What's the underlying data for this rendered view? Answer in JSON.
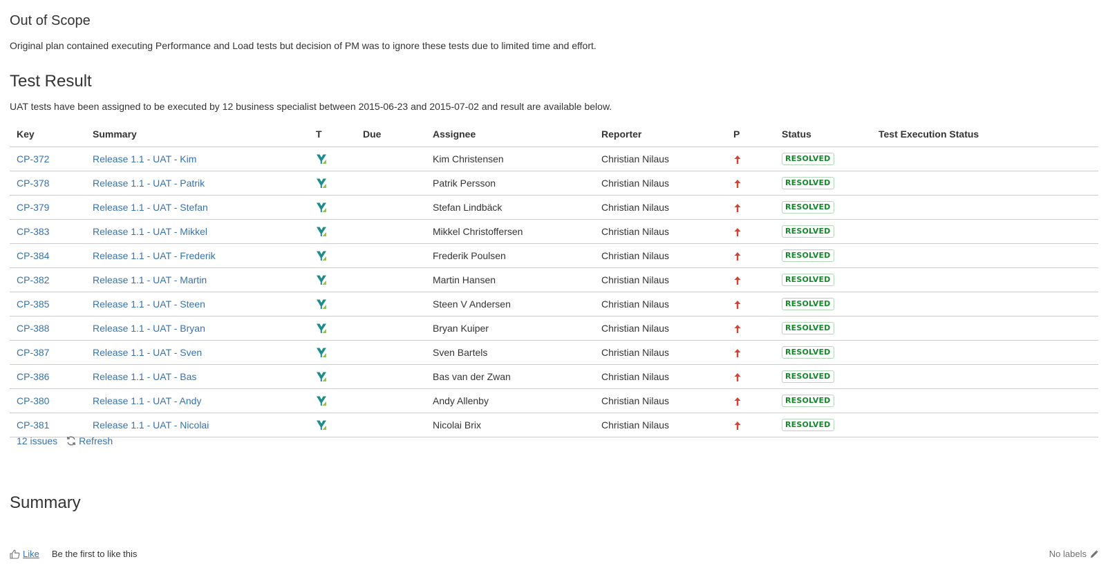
{
  "out_of_scope": {
    "title": "Out of Scope",
    "description": "Original plan contained executing Performance and Load tests but decision of PM was to ignore these tests due to limited time and effort."
  },
  "test_result": {
    "title": "Test Result",
    "description": "UAT tests have been assigned to be executed by 12 business specialist between 2015-06-23 and 2015-07-02 and result are available below.",
    "columns": {
      "key": "Key",
      "summary": "Summary",
      "type": "T",
      "due": "Due",
      "assignee": "Assignee",
      "reporter": "Reporter",
      "priority": "P",
      "status": "Status",
      "test_execution_status": "Test Execution Status"
    },
    "rows": [
      {
        "key": "CP-372",
        "summary": "Release 1.1 - UAT - Kim",
        "due": "",
        "assignee": "Kim Christensen",
        "reporter": "Christian Nilaus",
        "status": "RESOLVED"
      },
      {
        "key": "CP-378",
        "summary": "Release 1.1 - UAT - Patrik",
        "due": "",
        "assignee": "Patrik Persson",
        "reporter": "Christian Nilaus",
        "status": "RESOLVED"
      },
      {
        "key": "CP-379",
        "summary": "Release 1.1 - UAT - Stefan",
        "due": "",
        "assignee": "Stefan Lindbäck",
        "reporter": "Christian Nilaus",
        "status": "RESOLVED"
      },
      {
        "key": "CP-383",
        "summary": "Release 1.1 - UAT - Mikkel",
        "due": "",
        "assignee": "Mikkel Christoffersen",
        "reporter": "Christian Nilaus",
        "status": "RESOLVED"
      },
      {
        "key": "CP-384",
        "summary": "Release 1.1 - UAT - Frederik",
        "due": "",
        "assignee": "Frederik Poulsen",
        "reporter": "Christian Nilaus",
        "status": "RESOLVED"
      },
      {
        "key": "CP-382",
        "summary": "Release 1.1 - UAT - Martin",
        "due": "",
        "assignee": "Martin Hansen",
        "reporter": "Christian Nilaus",
        "status": "RESOLVED"
      },
      {
        "key": "CP-385",
        "summary": "Release 1.1 - UAT - Steen",
        "due": "",
        "assignee": "Steen V Andersen",
        "reporter": "Christian Nilaus",
        "status": "RESOLVED"
      },
      {
        "key": "CP-388",
        "summary": "Release 1.1 - UAT - Bryan",
        "due": "",
        "assignee": "Bryan Kuiper",
        "reporter": "Christian Nilaus",
        "status": "RESOLVED"
      },
      {
        "key": "CP-387",
        "summary": "Release 1.1 - UAT - Sven",
        "due": "",
        "assignee": "Sven Bartels",
        "reporter": "Christian Nilaus",
        "status": "RESOLVED"
      },
      {
        "key": "CP-386",
        "summary": "Release 1.1 - UAT - Bas",
        "due": "",
        "assignee": "Bas van der Zwan",
        "reporter": "Christian Nilaus",
        "status": "RESOLVED"
      },
      {
        "key": "CP-380",
        "summary": "Release 1.1 - UAT - Andy",
        "due": "",
        "assignee": "Andy Allenby",
        "reporter": "Christian Nilaus",
        "status": "RESOLVED"
      },
      {
        "key": "CP-381",
        "summary": "Release 1.1 - UAT - Nicolai",
        "due": "",
        "assignee": "Nicolai Brix",
        "reporter": "Christian Nilaus",
        "status": "RESOLVED"
      }
    ],
    "issue_count": "12 issues",
    "refresh_label": "Refresh"
  },
  "summary": {
    "title": "Summary"
  },
  "footer": {
    "like_label": "Like",
    "like_text": "Be the first to like this",
    "labels_text": "No labels"
  },
  "icons": {
    "type": "test-type-icon",
    "priority": "priority-major-arrow-icon",
    "refresh": "refresh-icon",
    "like": "thumbs-up-icon",
    "edit": "pencil-icon"
  },
  "colors": {
    "link": "#3572b0",
    "status_resolved": "#14892c",
    "priority_arrow": "#d04437"
  }
}
